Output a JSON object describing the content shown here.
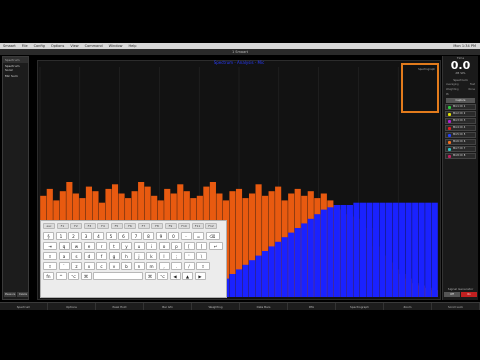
{
  "menubar": {
    "items": [
      "Smaart",
      "File",
      "Config",
      "Options",
      "View",
      "Command",
      "Window",
      "Help"
    ],
    "right": "Mon 1:34 PM"
  },
  "titlebar": {
    "title": "1 Smaart"
  },
  "left_panel": {
    "header": "Spectrum",
    "items": [
      "Spectrum Sonic",
      "Mic Sum"
    ],
    "buttons": [
      "Measure",
      "Delete"
    ]
  },
  "graph": {
    "title": "Spectrum - Analysis - Mic"
  },
  "orange_box_label": "Spectrograph",
  "right_panel": {
    "label": "Time",
    "value": "0.0",
    "unit": "dB SPL",
    "section": "Spectrum",
    "rows": [
      {
        "k": "Averaging",
        "v": "Fast"
      },
      {
        "k": "Weighting",
        "v": "None"
      },
      {
        "k": "Pk",
        "v": ""
      }
    ],
    "btn": "Capture",
    "channels": [
      {
        "name": "Mic1 Ch 1",
        "color": "#2ecc40"
      },
      {
        "name": "Mic2 Ch 2",
        "color": "#e0e000"
      },
      {
        "name": "Mic3 Ch 3",
        "color": "#b020d0"
      },
      {
        "name": "Mic4 Ch 4",
        "color": "#e02020"
      },
      {
        "name": "Mic5 Ch 5",
        "color": "#2040ff"
      },
      {
        "name": "Mic6 Ch 6",
        "color": "#f07020"
      },
      {
        "name": "Mic7 Ch 7",
        "color": "#30c0c0"
      },
      {
        "name": "Mic8 Ch 8",
        "color": "#c02060"
      }
    ],
    "footer_label": "Signal Generator",
    "footer_btns": [
      "Off",
      "On"
    ]
  },
  "toolbar": {
    "items": [
      "Spectrum",
      "Options",
      "Peak Hold",
      "Bar Gfx",
      "Weighting",
      "Data Bars",
      "RTA",
      "Spectrograph",
      "Zoom",
      "Scroll Lock"
    ]
  },
  "keyboard": {
    "frow": [
      "esc",
      "F1",
      "F2",
      "F3",
      "F4",
      "F5",
      "F6",
      "F7",
      "F8",
      "F9",
      "F10",
      "F11",
      "F12"
    ],
    "row1": [
      "§",
      "1",
      "2",
      "3",
      "4",
      "5",
      "6",
      "7",
      "8",
      "9",
      "0",
      "-",
      "=",
      "⌫"
    ],
    "row2": [
      "⇥",
      "q",
      "w",
      "e",
      "r",
      "t",
      "y",
      "u",
      "i",
      "o",
      "p",
      "[",
      "]",
      "↵"
    ],
    "row3": [
      "⇪",
      "a",
      "s",
      "d",
      "f",
      "g",
      "h",
      "j",
      "k",
      "l",
      ";",
      "'",
      "\\"
    ],
    "row4": [
      "⇧",
      "`",
      "z",
      "x",
      "c",
      "v",
      "b",
      "n",
      "m",
      ",",
      ".",
      "/",
      "⇧"
    ],
    "row5": [
      "fn",
      "^",
      "⌥",
      "⌘",
      "",
      "⌘",
      "⌥",
      "◀",
      "▲",
      "▶"
    ]
  },
  "chart_data": {
    "type": "bar",
    "series": [
      {
        "name": "",
        "color": "#e85a10",
        "values": [
          0.44,
          0.47,
          0.42,
          0.46,
          0.5,
          0.45,
          0.43,
          0.48,
          0.46,
          0.41,
          0.47,
          0.49,
          0.45,
          0.43,
          0.46,
          0.5,
          0.48,
          0.44,
          0.42,
          0.47,
          0.45,
          0.49,
          0.46,
          0.43,
          0.44,
          0.48,
          0.5,
          0.45,
          0.42,
          0.46,
          0.47,
          0.43,
          0.45,
          0.49,
          0.44,
          0.46,
          0.48,
          0.42,
          0.45,
          0.47,
          0.44,
          0.46,
          0.43,
          0.45,
          0.42,
          0.4,
          0.38,
          0.36,
          0.35,
          0.34,
          0.3,
          0.22,
          0.18,
          0.15,
          0.12,
          0.1,
          0.08,
          0.06,
          0.05,
          0.04,
          0.03
        ]
      },
      {
        "name": "",
        "color": "#1a22ff",
        "values": [
          0.05,
          0.06,
          0.04,
          0.05,
          0.08,
          0.06,
          0.05,
          0.04,
          0.07,
          0.06,
          0.05,
          0.04,
          0.06,
          0.05,
          0.07,
          0.05,
          0.04,
          0.06,
          0.05,
          0.06,
          0.05,
          0.07,
          0.06,
          0.05,
          0.06,
          0.07,
          0.05,
          0.06,
          0.08,
          0.1,
          0.12,
          0.14,
          0.16,
          0.18,
          0.2,
          0.22,
          0.24,
          0.26,
          0.28,
          0.3,
          0.32,
          0.34,
          0.36,
          0.38,
          0.39,
          0.4,
          0.4,
          0.4,
          0.41,
          0.41,
          0.41,
          0.41,
          0.41,
          0.41,
          0.41,
          0.41,
          0.41,
          0.41,
          0.41,
          0.41,
          0.41
        ]
      }
    ]
  }
}
